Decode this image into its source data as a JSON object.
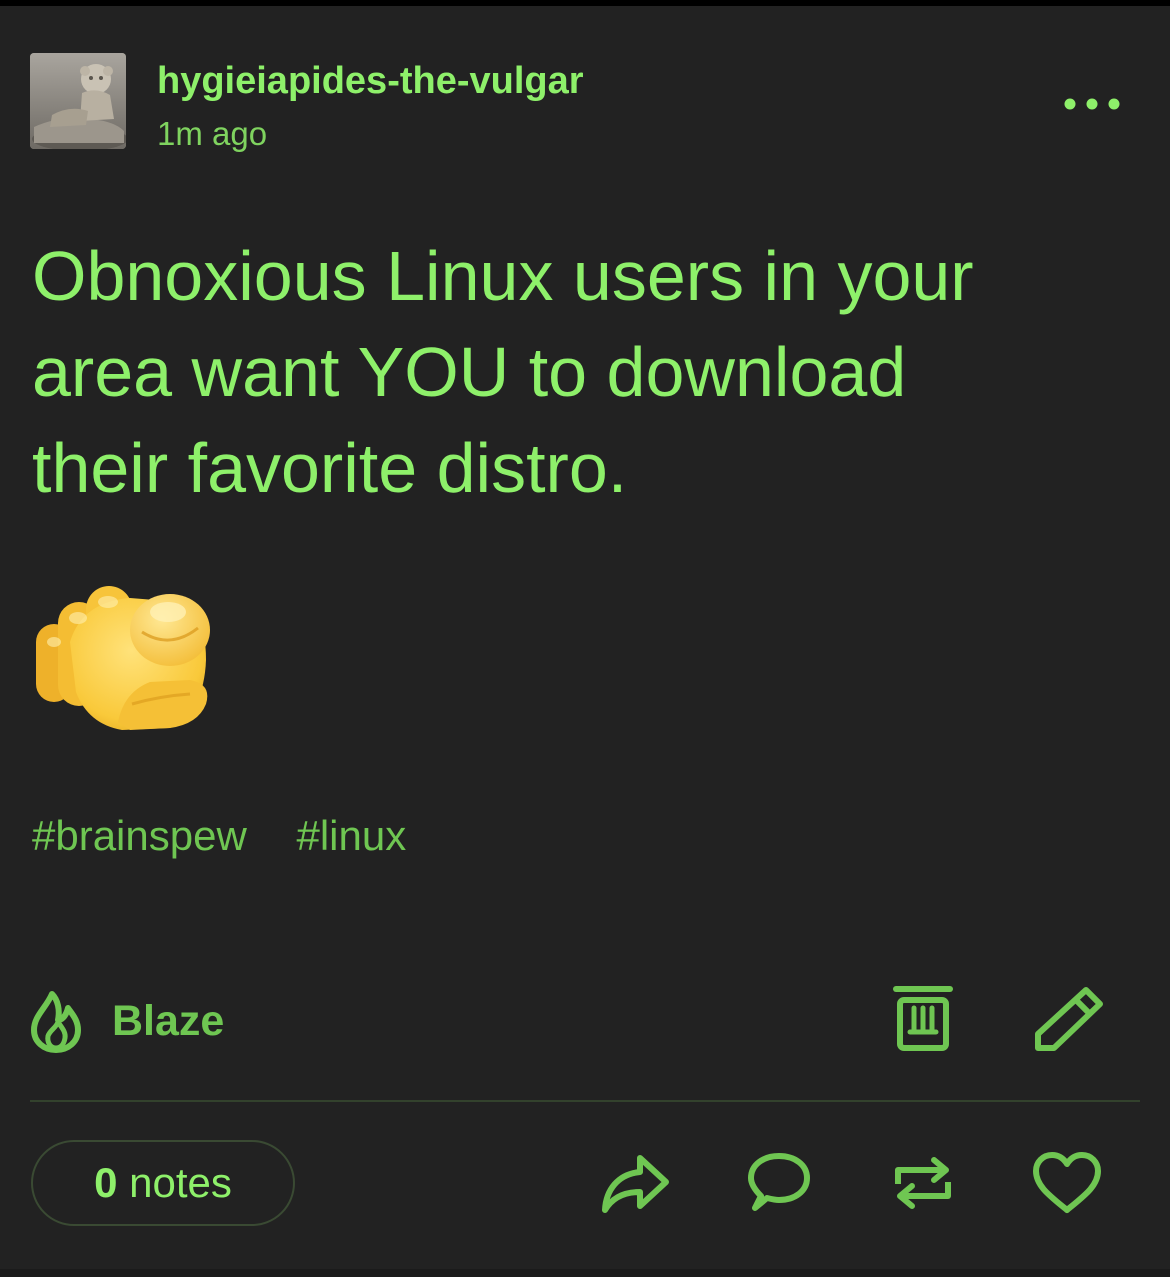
{
  "post": {
    "author": "hygieiapides-the-vulgar",
    "timestamp": "1m ago",
    "body_lines": [
      "Obnoxious Linux users in your",
      "area want YOU to download",
      "their favorite distro."
    ],
    "emoji": "pointing-at-viewer-emoji",
    "tags": [
      "#brainspew",
      "#linux"
    ]
  },
  "actions": {
    "blaze_label": "Blaze",
    "icons": [
      "more-icon",
      "blaze-icon",
      "delete-icon",
      "edit-icon",
      "share-icon",
      "reply-icon",
      "reblog-icon",
      "like-icon"
    ]
  },
  "footer": {
    "notes_count": "0",
    "notes_word": "notes"
  },
  "colors": {
    "background": "#222222",
    "accent": "#8ef06a",
    "accent_dim": "#6fc652"
  }
}
